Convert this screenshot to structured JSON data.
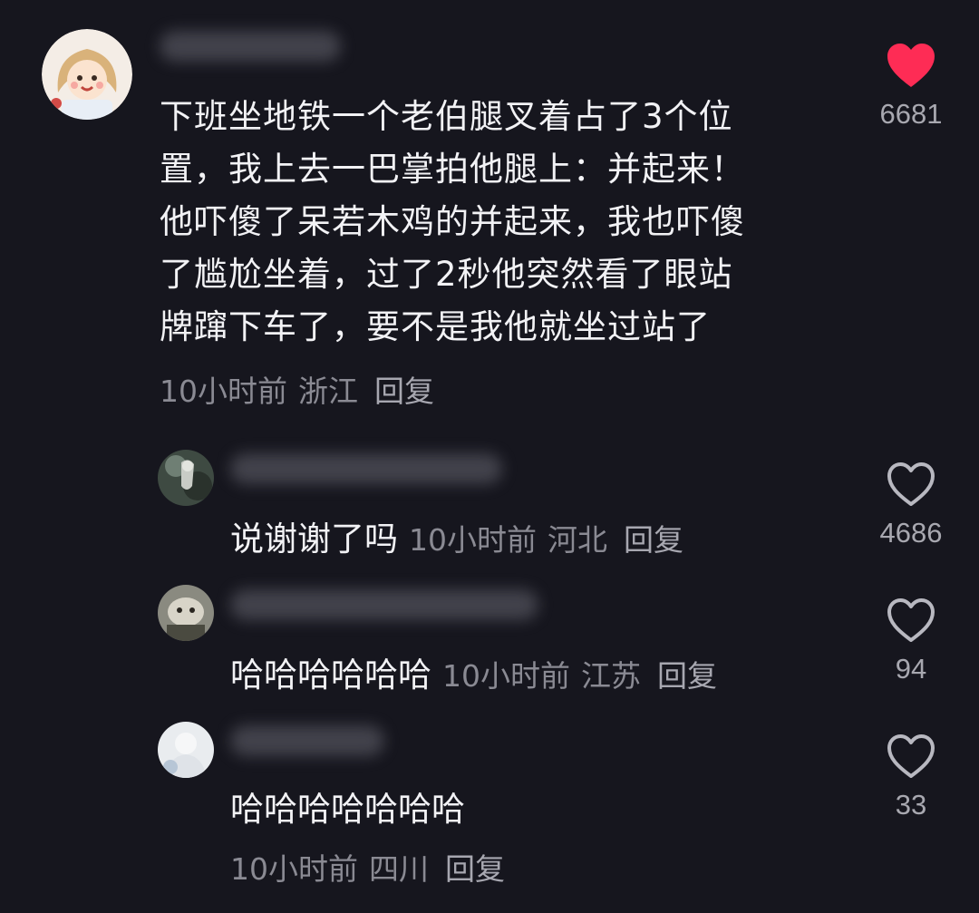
{
  "main_comment": {
    "lines": [
      "下班坐地铁一个老伯腿叉着占了3个位",
      "置，我上去一巴掌拍他腿上：并起来！",
      "他吓傻了呆若木鸡的并起来，我也吓傻",
      "了尴尬坐着，过了2秒他突然看了眼站",
      "牌蹿下车了，要不是我他就坐过站了"
    ],
    "time": "10小时前",
    "location": "浙江",
    "reply_label": "回复",
    "like_count": "6681",
    "liked": true
  },
  "replies": [
    {
      "text": "说谢谢了吗",
      "time": "10小时前",
      "location": "河北",
      "reply_label": "回复",
      "like_count": "4686"
    },
    {
      "text": "哈哈哈哈哈哈",
      "time": "10小时前",
      "location": "江苏",
      "reply_label": "回复",
      "like_count": "94"
    },
    {
      "text": "哈哈哈哈哈哈哈",
      "time": "10小时前",
      "location": "四川",
      "reply_label": "回复",
      "like_count": "33"
    }
  ],
  "colors": {
    "background": "#16161e",
    "like_active": "#fe2c55",
    "text": "#f2f2f5",
    "meta": "#8a8a93"
  },
  "icons": {
    "liked": "heart-filled-icon",
    "unliked": "heart-outline-icon"
  }
}
